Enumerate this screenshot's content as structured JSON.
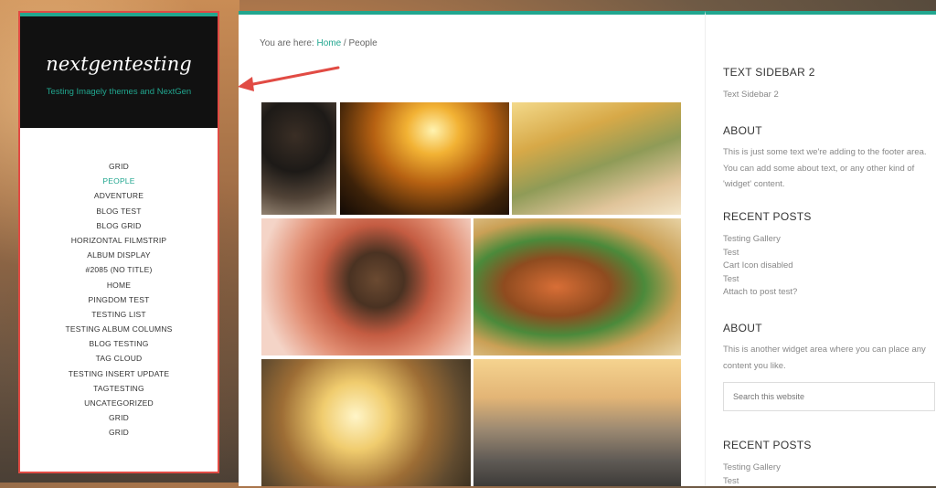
{
  "site": {
    "title": "nextgentesting",
    "description": "Testing Imagely themes and NextGen"
  },
  "nav": {
    "items": [
      {
        "label": "GRID"
      },
      {
        "label": "PEOPLE",
        "active": true
      },
      {
        "label": "ADVENTURE"
      },
      {
        "label": "BLOG TEST"
      },
      {
        "label": "BLOG GRID"
      },
      {
        "label": "HORIZONTAL FILMSTRIP"
      },
      {
        "label": "ALBUM DISPLAY"
      },
      {
        "label": "#2085 (NO TITLE)"
      },
      {
        "label": "HOME"
      },
      {
        "label": "PINGDOM TEST"
      },
      {
        "label": "TESTING LIST"
      },
      {
        "label": "TESTING ALBUM COLUMNS"
      },
      {
        "label": "BLOG TESTING"
      },
      {
        "label": "TAG CLOUD"
      },
      {
        "label": "TESTING INSERT UPDATE"
      },
      {
        "label": "TAGTESTING"
      },
      {
        "label": "UNCATEGORIZED"
      },
      {
        "label": "GRID"
      },
      {
        "label": "GRID"
      }
    ]
  },
  "breadcrumb": {
    "prefix": "You are here: ",
    "home": "Home",
    "separator": " / ",
    "current": "People"
  },
  "sidebar": {
    "text_sidebar": {
      "title": "TEXT SIDEBAR 2",
      "text": "Text Sidebar 2"
    },
    "about1": {
      "title": "ABOUT",
      "text": "This is just some text we're adding to the footer area. You can add some about text, or any other kind of 'widget' content."
    },
    "recent1": {
      "title": "RECENT POSTS",
      "links": [
        "Testing Gallery",
        "Test",
        "Cart Icon disabled",
        "Test",
        "Attach to post test?"
      ]
    },
    "about2": {
      "title": "ABOUT",
      "text": "This is another widget area where you can place any content you like."
    },
    "search": {
      "placeholder": "Search this website"
    },
    "recent2": {
      "title": "RECENT POSTS",
      "links": [
        "Testing Gallery",
        "Test"
      ]
    }
  },
  "colors": {
    "accent": "#21a68f",
    "annotation": "#e14b44"
  }
}
